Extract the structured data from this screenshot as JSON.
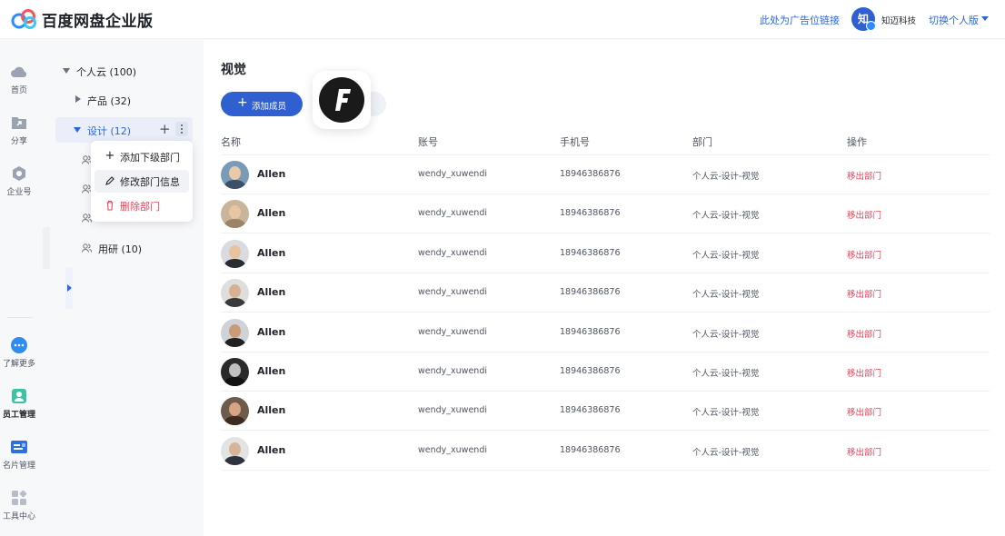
{
  "header": {
    "app_title": "百度网盘企业版",
    "ad_link": "此处为广告位链接",
    "avatar_initial": "知",
    "username": "知迈科技",
    "switch_version": "切换个人版"
  },
  "rail": {
    "top_items": [
      {
        "label": "首页",
        "icon": "cloud-icon"
      },
      {
        "label": "分享",
        "icon": "share-folder-icon"
      },
      {
        "label": "企业号",
        "icon": "gear-icon"
      }
    ],
    "bottom_items": [
      {
        "label": "了解更多",
        "icon": "more-chat-icon"
      },
      {
        "label": "员工管理",
        "icon": "staff-icon",
        "active": true
      },
      {
        "label": "名片管理",
        "icon": "card-icon"
      },
      {
        "label": "工具中心",
        "icon": "tools-icon"
      }
    ]
  },
  "tree": {
    "root": "个人云 (100)",
    "product": "产品 (32)",
    "design": "设计 (12)",
    "research": "用研 (10)"
  },
  "context_menu": {
    "add_sub": "添加下级部门",
    "edit": "修改部门信息",
    "delete": "删除部门"
  },
  "main": {
    "title": "视觉",
    "add_member": "添加成员",
    "columns": {
      "name": "名称",
      "account": "账号",
      "phone": "手机号",
      "dept": "部门",
      "action": "操作"
    },
    "rows": [
      {
        "name": "Allen",
        "account": "wendy_xuwendi",
        "phone": "18946386876",
        "dept": "个人云-设计-视觉",
        "action": "移出部门"
      },
      {
        "name": "Allen",
        "account": "wendy_xuwendi",
        "phone": "18946386876",
        "dept": "个人云-设计-视觉",
        "action": "移出部门"
      },
      {
        "name": "Allen",
        "account": "wendy_xuwendi",
        "phone": "18946386876",
        "dept": "个人云-设计-视觉",
        "action": "移出部门"
      },
      {
        "name": "Allen",
        "account": "wendy_xuwendi",
        "phone": "18946386876",
        "dept": "个人云-设计-视觉",
        "action": "移出部门"
      },
      {
        "name": "Allen",
        "account": "wendy_xuwendi",
        "phone": "18946386876",
        "dept": "个人云-设计-视觉",
        "action": "移出部门"
      },
      {
        "name": "Allen",
        "account": "wendy_xuwendi",
        "phone": "18946386876",
        "dept": "个人云-设计-视觉",
        "action": "移出部门"
      },
      {
        "name": "Allen",
        "account": "wendy_xuwendi",
        "phone": "18946386876",
        "dept": "个人云-设计-视觉",
        "action": "移出部门"
      },
      {
        "name": "Allen",
        "account": "wendy_xuwendi",
        "phone": "18946386876",
        "dept": "个人云-设计-视觉",
        "action": "移出部门"
      }
    ]
  },
  "colors": {
    "accent": "#2f5fd0",
    "link": "#2b66e0",
    "danger": "#e8455a"
  }
}
